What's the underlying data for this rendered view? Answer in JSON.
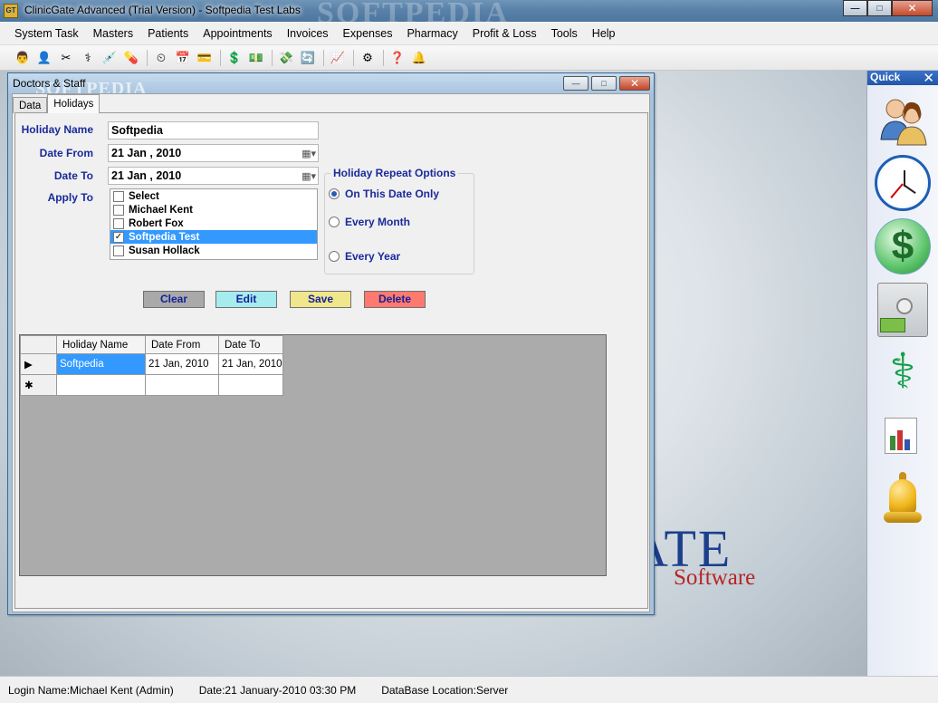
{
  "window": {
    "title": "ClinicGate Advanced (Trial Version) - Softpedia Test Labs",
    "app_icon": "GT",
    "watermark": "SOFTPEDIA",
    "min_label": "—",
    "max_label": "□",
    "close_label": "✕"
  },
  "menu": [
    "System Task",
    "Masters",
    "Patients",
    "Appointments",
    "Invoices",
    "Expenses",
    "Pharmacy",
    "Profit & Loss",
    "Tools",
    "Help"
  ],
  "toolbar": {
    "icons": [
      "👨",
      "👤",
      "✂",
      "⚕",
      "💉",
      "💊",
      "⏲",
      "📅",
      "💳",
      "💲",
      "💵",
      "💸",
      "🔄",
      "📈",
      "⚙",
      "❓",
      "🔔"
    ]
  },
  "desktop": {
    "logo_text": "ATE",
    "logo_sub": "Software"
  },
  "quick": {
    "title": "Quick",
    "close": "✕",
    "dollar": "$",
    "pharmacy": "⚕"
  },
  "status": {
    "login": "Login Name:Michael Kent (Admin)",
    "date": "Date:21 January-2010  03:30  PM",
    "db": "DataBase Location:Server"
  },
  "child": {
    "title": "Doctors & Staff",
    "watermark": "SOFTPEDIA",
    "tabs": [
      "Data",
      "Holidays"
    ],
    "active_tab": "Holidays",
    "labels": {
      "holiday_name": "Holiday Name",
      "date_from": "Date From",
      "date_to": "Date To",
      "apply_to": "Apply To"
    },
    "holiday_name": "Softpedia",
    "date_from": "21 Jan , 2010",
    "date_to": "21 Jan , 2010",
    "apply_list": [
      {
        "label": "Select",
        "checked": false,
        "selected": false
      },
      {
        "label": "Michael Kent",
        "checked": false,
        "selected": false
      },
      {
        "label": "Robert Fox",
        "checked": false,
        "selected": false
      },
      {
        "label": "Softpedia Test",
        "checked": true,
        "selected": true
      },
      {
        "label": "Susan Hollack",
        "checked": false,
        "selected": false
      }
    ],
    "repeat": {
      "title": "Holiday Repeat Options",
      "options": [
        "On This Date Only",
        "Every Month",
        "Every Year"
      ],
      "selected": "On This Date Only"
    },
    "buttons": {
      "clear": "Clear",
      "edit": "Edit",
      "save": "Save",
      "delete": "Delete"
    },
    "grid": {
      "columns": [
        "Holiday Name",
        "Date From",
        "Date To"
      ],
      "rows": [
        [
          "Softpedia",
          "21 Jan, 2010",
          "21 Jan, 2010"
        ]
      ],
      "current_row_marker": "▶",
      "new_row_marker": "✱"
    }
  }
}
